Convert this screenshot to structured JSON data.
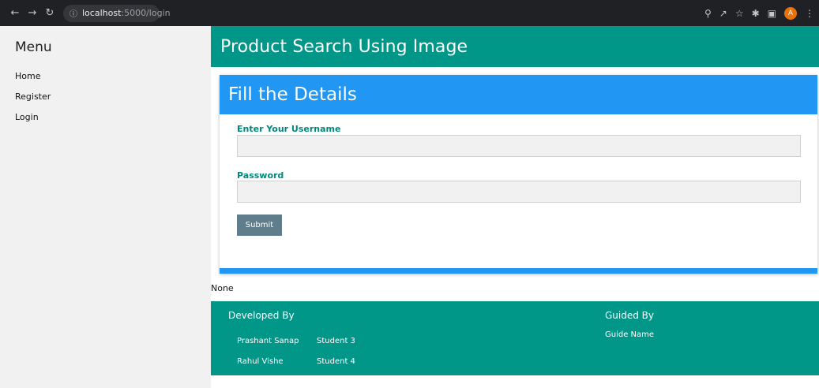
{
  "browser": {
    "url_host": "localhost",
    "url_path": ":5000/login",
    "avatar_letter": "A"
  },
  "sidebar": {
    "title": "Menu",
    "items": [
      {
        "label": "Home"
      },
      {
        "label": "Register"
      },
      {
        "label": "Login"
      }
    ]
  },
  "header": {
    "title": "Product Search Using Image"
  },
  "form": {
    "title": "Fill the Details",
    "username_label": "Enter Your Username",
    "username_value": "",
    "password_label": "Password",
    "password_value": "",
    "submit_label": "Submit"
  },
  "message": "None",
  "footer": {
    "developed_heading": "Developed By",
    "developers": [
      {
        "name": "Prashant Sanap",
        "partner": "Student 3"
      },
      {
        "name": "Rahul Vishe",
        "partner": "Student 4"
      }
    ],
    "guided_heading": "Guided By",
    "guide_name": "Guide Name"
  },
  "colors": {
    "primary_teal": "#009688",
    "card_blue": "#2196f3",
    "button_gray": "#607d8b",
    "label_teal": "#00897b",
    "sidebar_bg": "#f1f1f1",
    "chrome_bg": "#202124"
  }
}
